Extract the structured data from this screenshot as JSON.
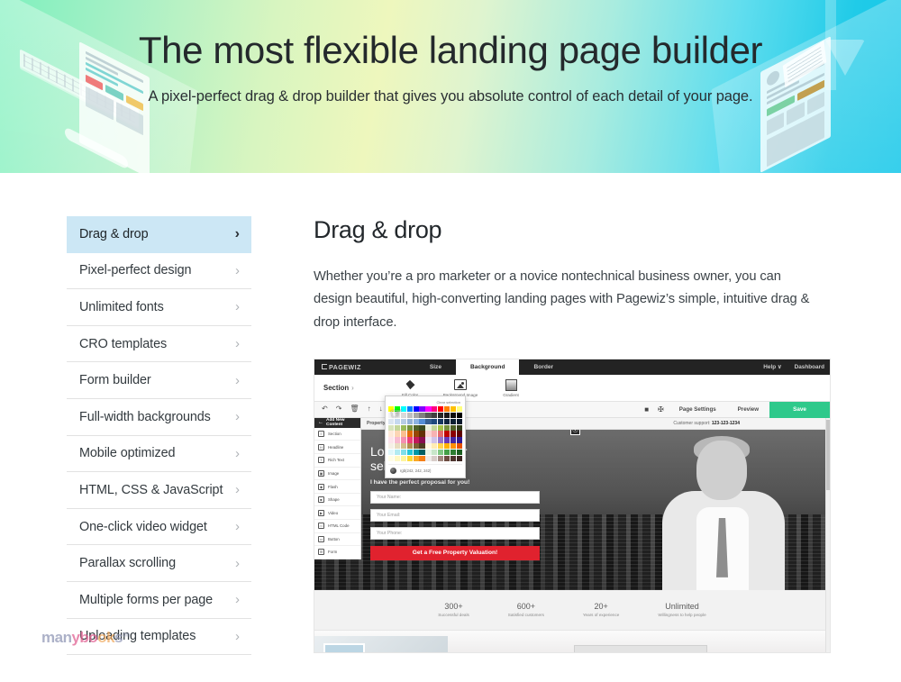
{
  "hero": {
    "title": "The most flexible landing page builder",
    "subtitle": "A pixel-perfect drag & drop builder that gives you absolute control of each detail of your page.",
    "gradient_from": "#7ef0be",
    "gradient_mid": "#eef7bd",
    "gradient_to": "#12c6e8"
  },
  "sidebar": {
    "active_index": 0,
    "active_bg": "#cce7f5",
    "items": [
      {
        "label": "Drag & drop",
        "chevron": "›"
      },
      {
        "label": "Pixel-perfect design",
        "chevron": "›"
      },
      {
        "label": "Unlimited fonts",
        "chevron": "›"
      },
      {
        "label": "CRO templates",
        "chevron": "›"
      },
      {
        "label": "Form builder",
        "chevron": "›"
      },
      {
        "label": "Full-width backgrounds",
        "chevron": "›"
      },
      {
        "label": "Mobile optimized",
        "chevron": "›"
      },
      {
        "label": "HTML, CSS & JavaScript",
        "chevron": "›"
      },
      {
        "label": "One-click video widget",
        "chevron": "›"
      },
      {
        "label": "Parallax scrolling",
        "chevron": "›"
      },
      {
        "label": "Multiple forms per page",
        "chevron": "›"
      },
      {
        "label": "Uploading templates",
        "chevron": "›"
      }
    ]
  },
  "watermark": {
    "part1": "man",
    "part2": "ybo",
    "part3": "ok",
    "part4": "s",
    "tm": "tm"
  },
  "main": {
    "heading": "Drag & drop",
    "paragraph": "Whether you’re a pro marketer or a novice nontechnical business owner, you can design beautiful, high-converting landing pages with Pagewiz’s simple, intuitive drag & drop interface."
  },
  "editor": {
    "logo": "PAGEWIZ",
    "tabs": [
      {
        "label": "Size",
        "active": false
      },
      {
        "label": "Background",
        "active": true
      },
      {
        "label": "Border",
        "active": false
      }
    ],
    "top_right": [
      "Help ∨",
      "Dashboard"
    ],
    "ribbon": {
      "section_label": "Section",
      "section_arrow": "›",
      "tools": [
        {
          "caption": "Fill Color",
          "icon": "paint-bucket-icon"
        },
        {
          "caption": "Background Image",
          "icon": "image-icon"
        },
        {
          "caption": "Gradient",
          "icon": "gradient-icon"
        }
      ]
    },
    "actions": {
      "left_icons": [
        "↶",
        "↷",
        "Ὕ1",
        "↑",
        "↓"
      ],
      "right_icons": [
        "■",
        "✠"
      ],
      "page_settings": "Page Settings",
      "preview": "Preview",
      "save": "Save",
      "save_color": "#2ec98b"
    },
    "content_panel": {
      "title": "Add New Content",
      "back": "←",
      "items": [
        {
          "label": "Section",
          "glyph": "≡"
        },
        {
          "label": "Headline",
          "glyph": "H"
        },
        {
          "label": "Rich Text",
          "glyph": "T"
        },
        {
          "label": "Image",
          "glyph": "▣"
        },
        {
          "label": "Flash",
          "glyph": "◆"
        },
        {
          "label": "Shape",
          "glyph": "■"
        },
        {
          "label": "Video",
          "glyph": "▶"
        },
        {
          "label": "HTML Code",
          "glyph": "</>"
        },
        {
          "label": "Button",
          "glyph": "▭"
        },
        {
          "label": "Form",
          "glyph": "☰"
        }
      ]
    },
    "color_picker": {
      "clear_label": "Clear selection",
      "current_value": "rgb(242, 242, 242)",
      "rows": [
        [
          "#ffff00",
          "#00ff00",
          "#00ffff",
          "#0080ff",
          "#0000ff",
          "#8000ff",
          "#ff00ff",
          "#ff0080",
          "#ff0000",
          "#ff8000",
          "#ffc000",
          "#ffff80"
        ],
        [
          "#f2f2f2",
          "#e6e6e6",
          "#d9d9d9",
          "#bfbfbf",
          "#a6a6a6",
          "#808080",
          "#595959",
          "#404040",
          "#262626",
          "#1a1a1a",
          "#0d0d0d",
          "#000000"
        ],
        [
          "#dce6f1",
          "#c6d9f0",
          "#b8cce4",
          "#95b3d7",
          "#8db3e2",
          "#558ed5",
          "#376092",
          "#1f497d",
          "#17375e",
          "#0f243e",
          "#0b1f33",
          "#08182a"
        ],
        [
          "#d8e4bc",
          "#c4d79b",
          "#9bbb59",
          "#77933c",
          "#4f6228",
          "#3b4a1f",
          "#ebf1dd",
          "#c3d69b",
          "#a5c249",
          "#76923c",
          "#4e6128",
          "#2e3a18"
        ],
        [
          "#fde9d9",
          "#fcd5b4",
          "#fabf8f",
          "#e36c0a",
          "#974806",
          "#632f05",
          "#fbd4d4",
          "#f7b2b2",
          "#e46c6c",
          "#c00000",
          "#8b0000",
          "#5e0000"
        ],
        [
          "#fce4ec",
          "#f8bbd0",
          "#f48fb1",
          "#ec407a",
          "#c2185b",
          "#880e4f",
          "#ede7f6",
          "#d1c4e9",
          "#9575cd",
          "#673ab7",
          "#4527a0",
          "#311b92"
        ],
        [
          "#f5f0e6",
          "#e8dcc0",
          "#d4bc8b",
          "#b08d4f",
          "#7d6134",
          "#4f3d20",
          "#fff8e1",
          "#ffecb3",
          "#ffd54f",
          "#ffb300",
          "#ff8f00",
          "#e65100"
        ],
        [
          "#e0f7fa",
          "#b2ebf2",
          "#80deea",
          "#26c6da",
          "#0097a7",
          "#006064",
          "#e8f5e9",
          "#c8e6c9",
          "#81c784",
          "#43a047",
          "#2e7d32",
          "#1b5e20"
        ],
        [
          "#fffde7",
          "#fff9c4",
          "#fff59d",
          "#fdd835",
          "#f9a825",
          "#f57f17",
          "#efebe9",
          "#d7ccc8",
          "#a1887f",
          "#6d4c41",
          "#4e342e",
          "#3e2723"
        ]
      ]
    }
  },
  "landing_preview": {
    "brand": "Property Group",
    "support_label": "Customer support:",
    "support_phone": "123-123-1234",
    "headline_line1": "Looking to buy or",
    "headline_line2": "sell a property?",
    "subheadline": "I have the perfect proposal for you!",
    "fields": [
      "Your Name:",
      "Your Email:",
      "Your Phone:"
    ],
    "cta": "Get a Free Property Valuation!",
    "cta_color": "#e0222e",
    "stats": [
      {
        "number": "300+",
        "caption": "Successful deals"
      },
      {
        "number": "600+",
        "caption": "Satisfied customers"
      },
      {
        "number": "20+",
        "caption": "Years of experience"
      },
      {
        "number": "Unlimited",
        "caption": "Willingness to help people"
      }
    ]
  }
}
